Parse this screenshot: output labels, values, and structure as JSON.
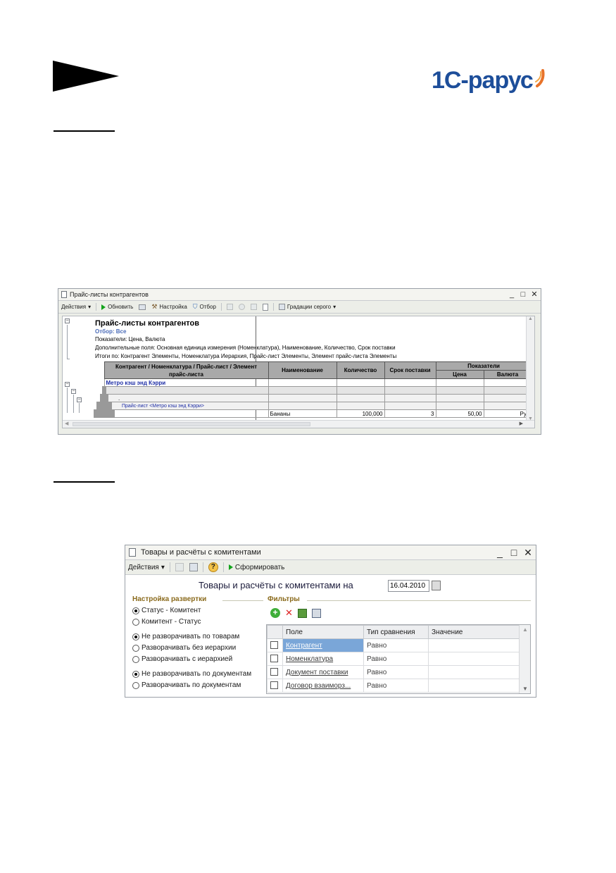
{
  "logo": {
    "text": "1С-рарус"
  },
  "window1": {
    "title": "Прайс-листы контрагентов",
    "toolbar": {
      "actions": "Действия",
      "refresh": "Обновить",
      "settings": "Настройка",
      "filter": "Отбор",
      "grayscale": "Градации серого"
    },
    "report": {
      "title": "Прайс-листы контрагентов",
      "filter": "Отбор: Все",
      "indicators": "Показатели: Цена, Валюта",
      "extra_fields": "Дополнительные поля: Основная единица измерения (Номенклатура), Наименование, Количество, Срок поставки",
      "totals_by": "Итоги по: Контрагент Элементы, Номенклатура Иерархия, Прайс-лист Элементы, Элемент прайс-листа Элементы",
      "headers": {
        "group_col": "Контрагент / Номенклатура / Прайс-лист / Элемент прайс-листа",
        "name": "Наименование",
        "quantity": "Количество",
        "term": "Срок поставки",
        "indicators": "Показатели",
        "price": "Цена",
        "currency": "Валюта"
      },
      "rows": {
        "counterparty": "Метро кэш энд Кэрри",
        "sub_marker": ".",
        "price_list": "Прайс-лист <Метро кэш энд Кэрри>",
        "item": {
          "name": "Бананы",
          "quantity": "100,000",
          "term": "3",
          "price": "50,00",
          "currency": "Руб"
        }
      }
    }
  },
  "window2": {
    "title": "Товары и расчёты с комитентами",
    "toolbar": {
      "actions": "Действия",
      "generate": "Сформировать",
      "help": "?"
    },
    "header_label": "Товары и расчёты с комитентами на",
    "date": "16.04.2010",
    "settings_caption": "Настройка развертки",
    "filters_caption": "Фильтры",
    "radio_group1": [
      "Статус - Комитент",
      "Комитент - Статус"
    ],
    "radio_group2": [
      "Не разворачивать по товарам",
      "Разворачивать без иерархии",
      "Разворачивать с иерархией"
    ],
    "radio_group3": [
      "Не разворачивать по документам",
      "Разворачивать по документам"
    ],
    "grid": {
      "headers": [
        "Поле",
        "Тип сравнения",
        "Значение"
      ],
      "rows": [
        {
          "field": "Контрагент",
          "compare": "Равно"
        },
        {
          "field": "Номенклатура",
          "compare": "Равно"
        },
        {
          "field": "Документ поставки",
          "compare": "Равно"
        },
        {
          "field": "Договор взаиморз...",
          "compare": "Равно"
        }
      ]
    }
  }
}
